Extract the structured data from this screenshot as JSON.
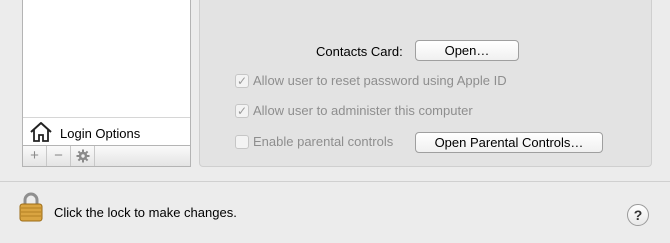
{
  "sidebar": {
    "login_options_label": "Login Options",
    "toolbar": {
      "add_symbol": "+",
      "remove_symbol": "−",
      "action_icon": "gear-icon"
    }
  },
  "details": {
    "contacts_card_label": "Contacts Card:",
    "open_button_label": "Open…",
    "options": [
      {
        "label": "Allow user to reset password using Apple ID",
        "checked": true,
        "enabled": false
      },
      {
        "label": "Allow user to administer this computer",
        "checked": true,
        "enabled": false
      },
      {
        "label": "Enable parental controls",
        "checked": false,
        "enabled": false
      }
    ],
    "parental_controls_button_label": "Open Parental Controls…"
  },
  "footer": {
    "lock_text": "Click the lock to make changes.",
    "help_symbol": "?"
  }
}
